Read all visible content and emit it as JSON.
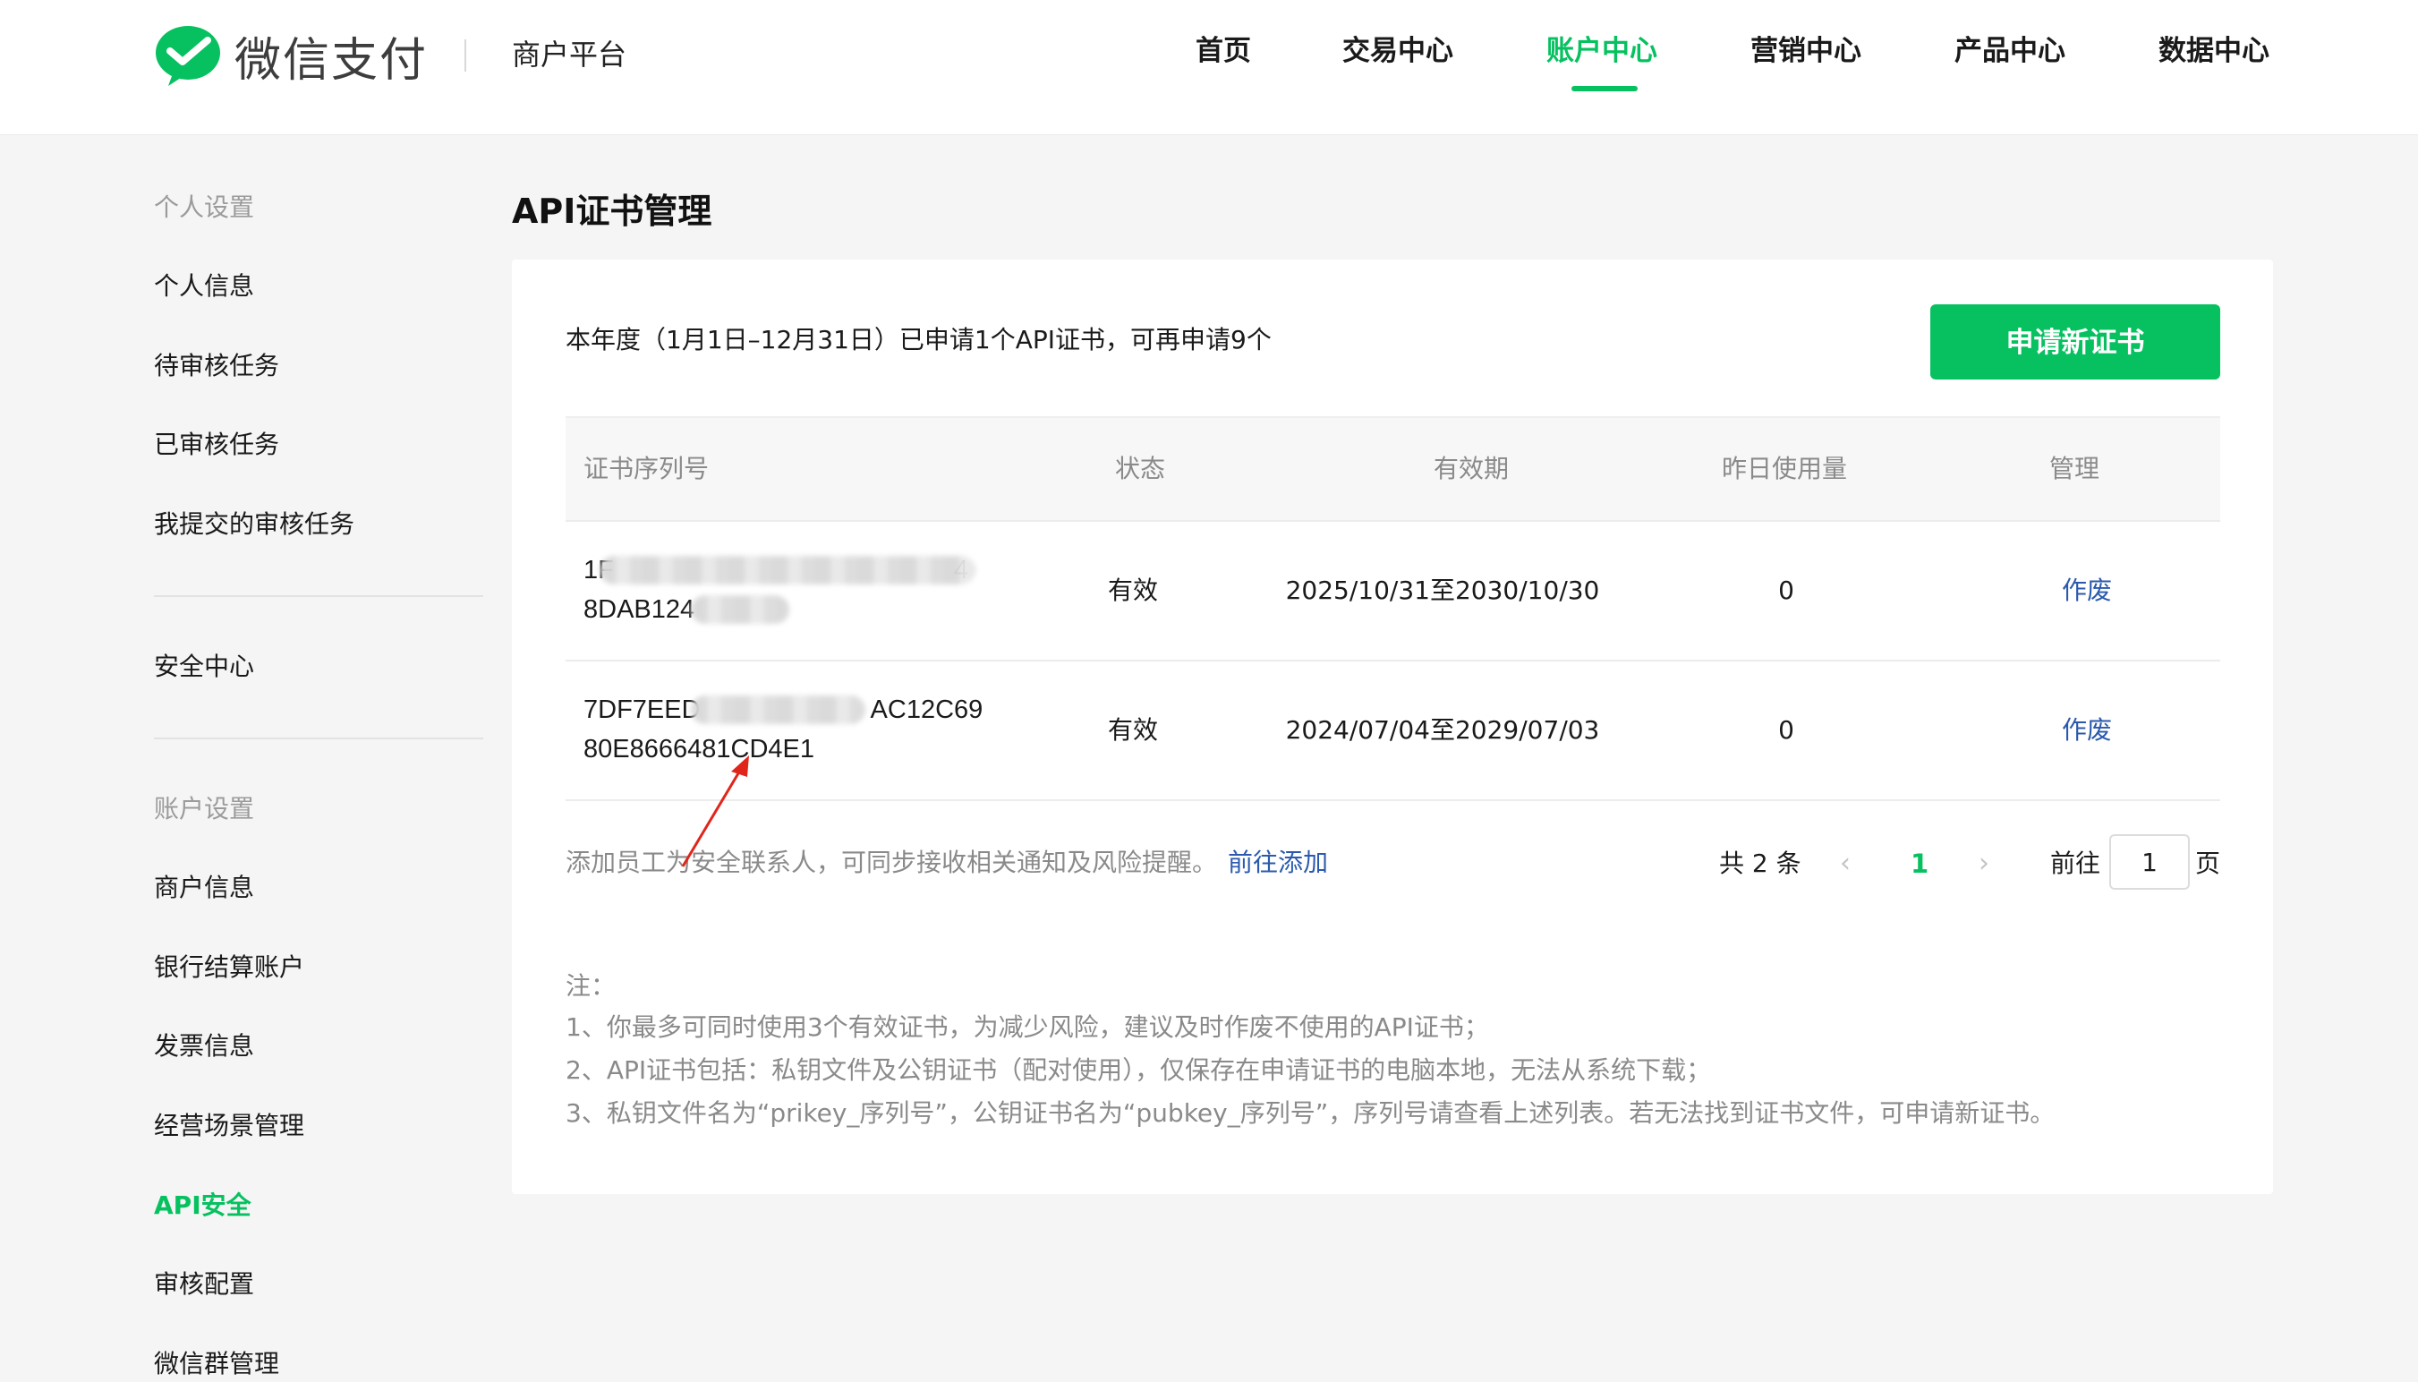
{
  "header": {
    "logo_text": "微信支付",
    "platform": "商户平台",
    "nav": [
      {
        "label": "首页",
        "active": false
      },
      {
        "label": "交易中心",
        "active": false
      },
      {
        "label": "账户中心",
        "active": true
      },
      {
        "label": "营销中心",
        "active": false
      },
      {
        "label": "产品中心",
        "active": false
      },
      {
        "label": "数据中心",
        "active": false
      }
    ]
  },
  "sidebar": {
    "group_personal": "个人设置",
    "personal_items": [
      "个人信息",
      "待审核任务",
      "已审核任务",
      "我提交的审核任务"
    ],
    "security_center": "安全中心",
    "group_account": "账户设置",
    "account_items": [
      "商户信息",
      "银行结算账户",
      "发票信息",
      "经营场景管理",
      "API安全",
      "审核配置",
      "微信群管理"
    ],
    "active_item": "API安全"
  },
  "main": {
    "title": "API证书管理",
    "quota_text": "本年度（1月1日–12月31日）已申请1个API证书，可再申请9个",
    "apply_button": "申请新证书",
    "table": {
      "headers": [
        "证书序列号",
        "状态",
        "有效期",
        "昨日使用量",
        "管理"
      ],
      "rows": [
        {
          "serial_line1": "1F",
          "serial_line1_end": "4",
          "serial_line2": "8DAB124",
          "status": "有效",
          "validity": "2025/10/31至2030/10/30",
          "usage": "0",
          "action": "作废"
        },
        {
          "serial_line1": "7DF7EED",
          "serial_line1_end": "AC12C69",
          "serial_line2": "80E8666481CD4E1",
          "status": "有效",
          "validity": "2024/07/04至2029/07/03",
          "usage": "0",
          "action": "作废"
        }
      ]
    },
    "contact_text": "添加员工为安全联系人，可同步接收相关通知及风险提醒。",
    "contact_link": "前往添加",
    "pager": {
      "total": "共 2 条",
      "prev": "‹",
      "current": "1",
      "next": "›",
      "goto_label": "前往",
      "page_input": "1",
      "page_suffix": "页"
    },
    "notes": {
      "title": "注：",
      "lines": [
        "1、你最多可同时使用3个有效证书，为减少风险，建议及时作废不使用的API证书；",
        "2、API证书包括：私钥文件及公钥证书（配对使用），仅保存在申请证书的电脑本地，无法从系统下载；",
        "3、私钥文件名为“prikey_序列号”，公钥证书名为“pubkey_序列号”，序列号请查看上述列表。若无法找到证书文件，可申请新证书。"
      ]
    }
  },
  "colors": {
    "brand_green": "#07c160",
    "link_blue": "#2b5aad",
    "annotation_red": "#e0261b"
  }
}
